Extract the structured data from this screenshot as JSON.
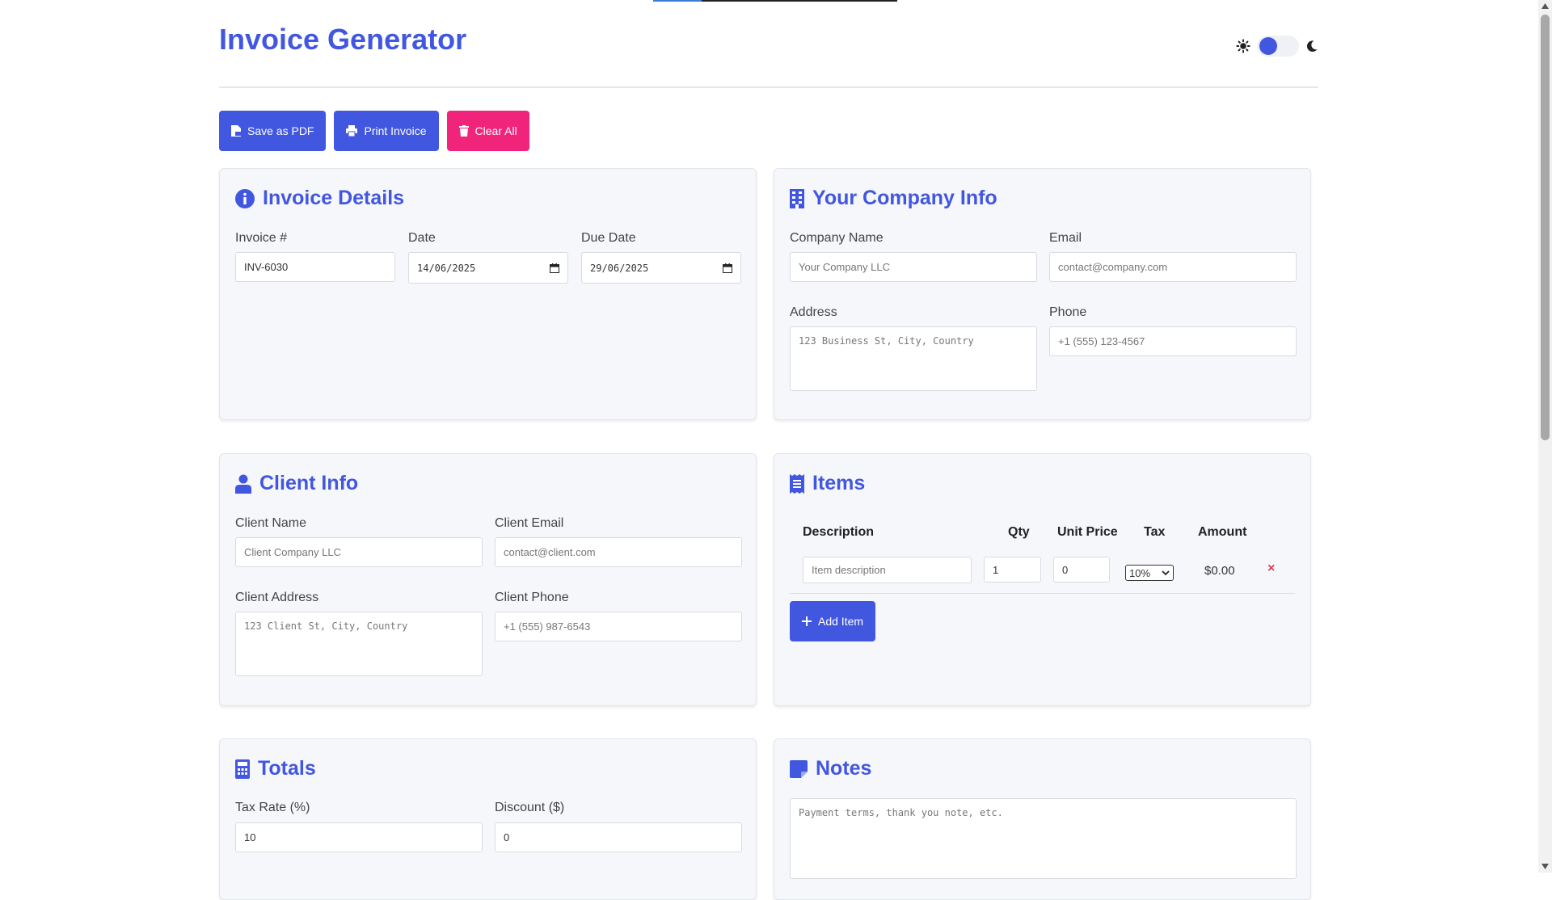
{
  "progress": {
    "fraction": 0.2,
    "color": "#3a7bd5"
  },
  "header": {
    "title": "Invoice Generator",
    "theme_light_icon": "sun-icon",
    "theme_dark_icon": "moon-icon"
  },
  "toolbar": {
    "save_pdf": "Save as PDF",
    "print": "Print Invoice",
    "clear": "Clear All"
  },
  "invoice_details": {
    "title": "Invoice Details",
    "invoice_number_label": "Invoice #",
    "invoice_number": "INV-6030",
    "date_label": "Date",
    "date": "14/06/2025",
    "due_date_label": "Due Date",
    "due_date": "29/06/2025"
  },
  "company": {
    "title": "Your Company Info",
    "name_label": "Company Name",
    "name_placeholder": "Your Company LLC",
    "email_label": "Email",
    "email_placeholder": "contact@company.com",
    "address_label": "Address",
    "address_placeholder": "123 Business St, City, Country",
    "phone_label": "Phone",
    "phone_placeholder": "+1 (555) 123-4567"
  },
  "client": {
    "title": "Client Info",
    "name_label": "Client Name",
    "name_placeholder": "Client Company LLC",
    "email_label": "Client Email",
    "email_placeholder": "contact@client.com",
    "address_label": "Client Address",
    "address_placeholder": "123 Client St, City, Country",
    "phone_label": "Client Phone",
    "phone_placeholder": "+1 (555) 987-6543"
  },
  "items": {
    "title": "Items",
    "columns": {
      "description": "Description",
      "qty": "Qty",
      "unit_price": "Unit Price",
      "tax": "Tax",
      "amount": "Amount"
    },
    "rows": [
      {
        "description_placeholder": "Item description",
        "qty": "1",
        "unit_price": "0",
        "tax": "10%",
        "amount": "$0.00",
        "remove": "×"
      }
    ],
    "add_label": "Add Item"
  },
  "totals": {
    "title": "Totals",
    "tax_rate_label": "Tax Rate (%)",
    "tax_rate": "10",
    "discount_label": "Discount ($)",
    "discount": "0"
  },
  "notes": {
    "title": "Notes",
    "placeholder": "Payment terms, thank you note, etc."
  },
  "colors": {
    "accent": "#4257e0",
    "danger": "#f0247a",
    "card_bg": "#f6f7fa"
  }
}
